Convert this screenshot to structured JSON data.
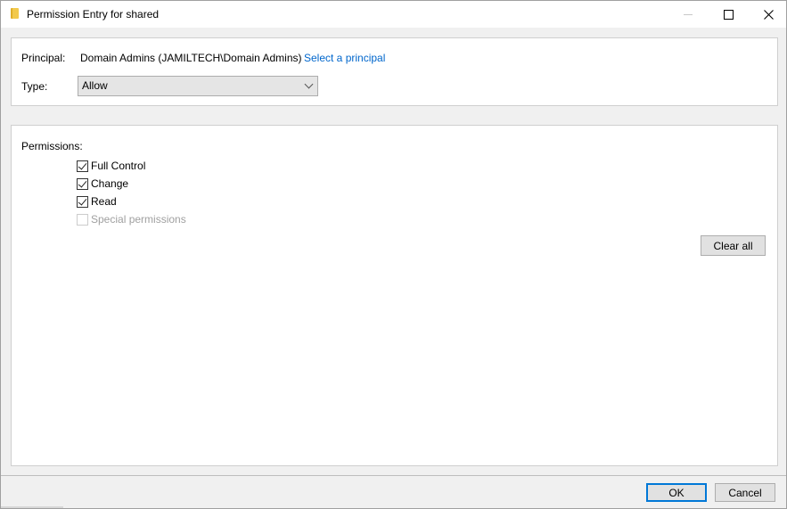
{
  "window": {
    "title": "Permission Entry for shared",
    "icon": "folder-icon",
    "controls": {
      "minimize": "minimize-icon",
      "maximize": "maximize-icon",
      "close": "close-icon"
    }
  },
  "principal_group": {
    "principal_label": "Principal:",
    "principal_value": "Domain Admins (JAMILTECH\\Domain Admins)",
    "select_principal_link": "Select a principal",
    "type_label": "Type:",
    "type_value": "Allow"
  },
  "permissions_group": {
    "label": "Permissions:",
    "items": [
      {
        "label": "Full Control",
        "checked": true,
        "enabled": true
      },
      {
        "label": "Change",
        "checked": true,
        "enabled": true
      },
      {
        "label": "Read",
        "checked": true,
        "enabled": true
      },
      {
        "label": "Special permissions",
        "checked": false,
        "enabled": false
      }
    ],
    "clear_all_label": "Clear all"
  },
  "footer": {
    "ok_label": "OK",
    "cancel_label": "Cancel"
  }
}
